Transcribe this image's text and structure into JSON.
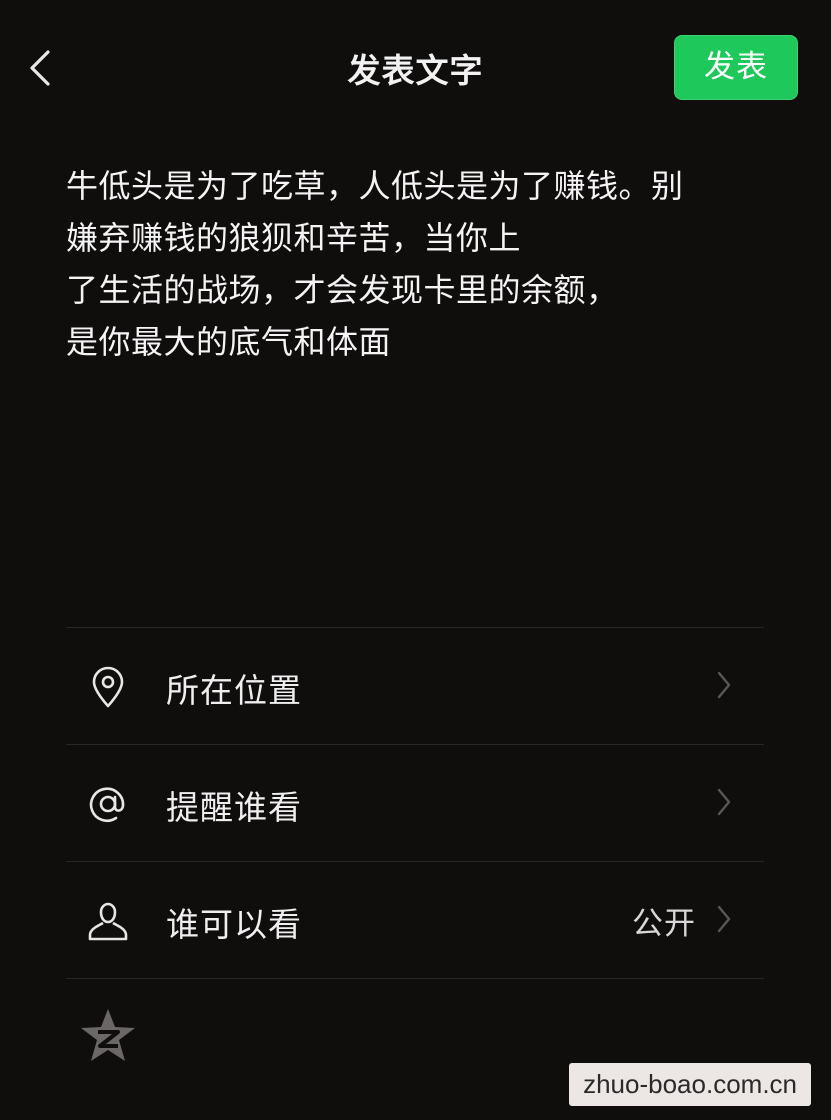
{
  "header": {
    "title": "发表文字",
    "publish_label": "发表"
  },
  "post": {
    "lines": [
      "牛低头是为了吃草，人低头是为了赚钱。别",
      "嫌弃赚钱的狼狈和辛苦，当你上",
      "了生活的战场，才会发现卡里的余额，",
      "是你最大的底气和体面"
    ]
  },
  "options": [
    {
      "label": "所在位置",
      "value": "",
      "icon": "location-pin-icon"
    },
    {
      "label": "提醒谁看",
      "value": "",
      "icon": "at-sign-icon"
    },
    {
      "label": "谁可以看",
      "value": "公开",
      "icon": "person-icon"
    }
  ],
  "footer": {
    "icon": "qzone-star-icon",
    "watermark": "zhuo-boao.com.cn"
  },
  "colors": {
    "background": "#100d0d",
    "accent": "#1fc85a",
    "text": "#f4f4f4",
    "divider": "#2a2626"
  }
}
